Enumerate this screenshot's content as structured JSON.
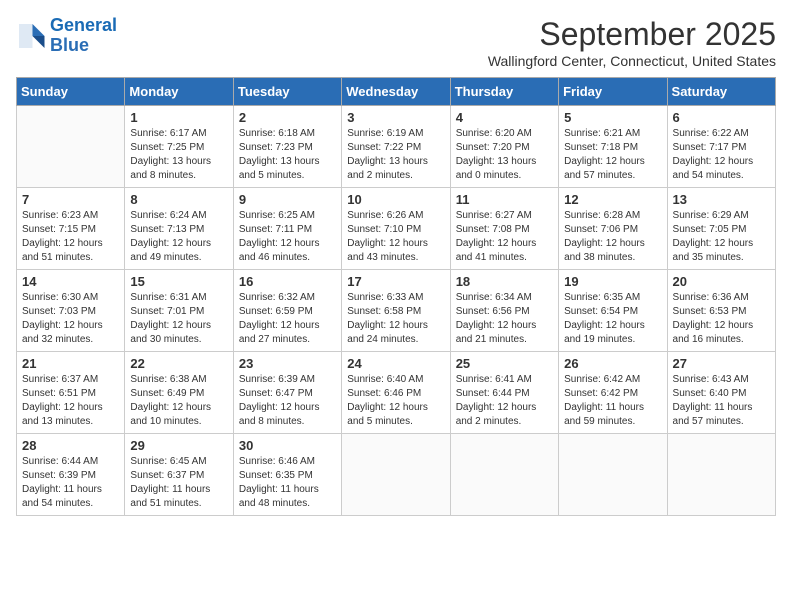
{
  "logo": {
    "line1": "General",
    "line2": "Blue"
  },
  "title": "September 2025",
  "location": "Wallingford Center, Connecticut, United States",
  "days_of_week": [
    "Sunday",
    "Monday",
    "Tuesday",
    "Wednesday",
    "Thursday",
    "Friday",
    "Saturday"
  ],
  "weeks": [
    [
      {
        "day": "",
        "sunrise": "",
        "sunset": "",
        "daylight": ""
      },
      {
        "day": "1",
        "sunrise": "Sunrise: 6:17 AM",
        "sunset": "Sunset: 7:25 PM",
        "daylight": "Daylight: 13 hours and 8 minutes."
      },
      {
        "day": "2",
        "sunrise": "Sunrise: 6:18 AM",
        "sunset": "Sunset: 7:23 PM",
        "daylight": "Daylight: 13 hours and 5 minutes."
      },
      {
        "day": "3",
        "sunrise": "Sunrise: 6:19 AM",
        "sunset": "Sunset: 7:22 PM",
        "daylight": "Daylight: 13 hours and 2 minutes."
      },
      {
        "day": "4",
        "sunrise": "Sunrise: 6:20 AM",
        "sunset": "Sunset: 7:20 PM",
        "daylight": "Daylight: 13 hours and 0 minutes."
      },
      {
        "day": "5",
        "sunrise": "Sunrise: 6:21 AM",
        "sunset": "Sunset: 7:18 PM",
        "daylight": "Daylight: 12 hours and 57 minutes."
      },
      {
        "day": "6",
        "sunrise": "Sunrise: 6:22 AM",
        "sunset": "Sunset: 7:17 PM",
        "daylight": "Daylight: 12 hours and 54 minutes."
      }
    ],
    [
      {
        "day": "7",
        "sunrise": "Sunrise: 6:23 AM",
        "sunset": "Sunset: 7:15 PM",
        "daylight": "Daylight: 12 hours and 51 minutes."
      },
      {
        "day": "8",
        "sunrise": "Sunrise: 6:24 AM",
        "sunset": "Sunset: 7:13 PM",
        "daylight": "Daylight: 12 hours and 49 minutes."
      },
      {
        "day": "9",
        "sunrise": "Sunrise: 6:25 AM",
        "sunset": "Sunset: 7:11 PM",
        "daylight": "Daylight: 12 hours and 46 minutes."
      },
      {
        "day": "10",
        "sunrise": "Sunrise: 6:26 AM",
        "sunset": "Sunset: 7:10 PM",
        "daylight": "Daylight: 12 hours and 43 minutes."
      },
      {
        "day": "11",
        "sunrise": "Sunrise: 6:27 AM",
        "sunset": "Sunset: 7:08 PM",
        "daylight": "Daylight: 12 hours and 41 minutes."
      },
      {
        "day": "12",
        "sunrise": "Sunrise: 6:28 AM",
        "sunset": "Sunset: 7:06 PM",
        "daylight": "Daylight: 12 hours and 38 minutes."
      },
      {
        "day": "13",
        "sunrise": "Sunrise: 6:29 AM",
        "sunset": "Sunset: 7:05 PM",
        "daylight": "Daylight: 12 hours and 35 minutes."
      }
    ],
    [
      {
        "day": "14",
        "sunrise": "Sunrise: 6:30 AM",
        "sunset": "Sunset: 7:03 PM",
        "daylight": "Daylight: 12 hours and 32 minutes."
      },
      {
        "day": "15",
        "sunrise": "Sunrise: 6:31 AM",
        "sunset": "Sunset: 7:01 PM",
        "daylight": "Daylight: 12 hours and 30 minutes."
      },
      {
        "day": "16",
        "sunrise": "Sunrise: 6:32 AM",
        "sunset": "Sunset: 6:59 PM",
        "daylight": "Daylight: 12 hours and 27 minutes."
      },
      {
        "day": "17",
        "sunrise": "Sunrise: 6:33 AM",
        "sunset": "Sunset: 6:58 PM",
        "daylight": "Daylight: 12 hours and 24 minutes."
      },
      {
        "day": "18",
        "sunrise": "Sunrise: 6:34 AM",
        "sunset": "Sunset: 6:56 PM",
        "daylight": "Daylight: 12 hours and 21 minutes."
      },
      {
        "day": "19",
        "sunrise": "Sunrise: 6:35 AM",
        "sunset": "Sunset: 6:54 PM",
        "daylight": "Daylight: 12 hours and 19 minutes."
      },
      {
        "day": "20",
        "sunrise": "Sunrise: 6:36 AM",
        "sunset": "Sunset: 6:53 PM",
        "daylight": "Daylight: 12 hours and 16 minutes."
      }
    ],
    [
      {
        "day": "21",
        "sunrise": "Sunrise: 6:37 AM",
        "sunset": "Sunset: 6:51 PM",
        "daylight": "Daylight: 12 hours and 13 minutes."
      },
      {
        "day": "22",
        "sunrise": "Sunrise: 6:38 AM",
        "sunset": "Sunset: 6:49 PM",
        "daylight": "Daylight: 12 hours and 10 minutes."
      },
      {
        "day": "23",
        "sunrise": "Sunrise: 6:39 AM",
        "sunset": "Sunset: 6:47 PM",
        "daylight": "Daylight: 12 hours and 8 minutes."
      },
      {
        "day": "24",
        "sunrise": "Sunrise: 6:40 AM",
        "sunset": "Sunset: 6:46 PM",
        "daylight": "Daylight: 12 hours and 5 minutes."
      },
      {
        "day": "25",
        "sunrise": "Sunrise: 6:41 AM",
        "sunset": "Sunset: 6:44 PM",
        "daylight": "Daylight: 12 hours and 2 minutes."
      },
      {
        "day": "26",
        "sunrise": "Sunrise: 6:42 AM",
        "sunset": "Sunset: 6:42 PM",
        "daylight": "Daylight: 11 hours and 59 minutes."
      },
      {
        "day": "27",
        "sunrise": "Sunrise: 6:43 AM",
        "sunset": "Sunset: 6:40 PM",
        "daylight": "Daylight: 11 hours and 57 minutes."
      }
    ],
    [
      {
        "day": "28",
        "sunrise": "Sunrise: 6:44 AM",
        "sunset": "Sunset: 6:39 PM",
        "daylight": "Daylight: 11 hours and 54 minutes."
      },
      {
        "day": "29",
        "sunrise": "Sunrise: 6:45 AM",
        "sunset": "Sunset: 6:37 PM",
        "daylight": "Daylight: 11 hours and 51 minutes."
      },
      {
        "day": "30",
        "sunrise": "Sunrise: 6:46 AM",
        "sunset": "Sunset: 6:35 PM",
        "daylight": "Daylight: 11 hours and 48 minutes."
      },
      {
        "day": "",
        "sunrise": "",
        "sunset": "",
        "daylight": ""
      },
      {
        "day": "",
        "sunrise": "",
        "sunset": "",
        "daylight": ""
      },
      {
        "day": "",
        "sunrise": "",
        "sunset": "",
        "daylight": ""
      },
      {
        "day": "",
        "sunrise": "",
        "sunset": "",
        "daylight": ""
      }
    ]
  ]
}
